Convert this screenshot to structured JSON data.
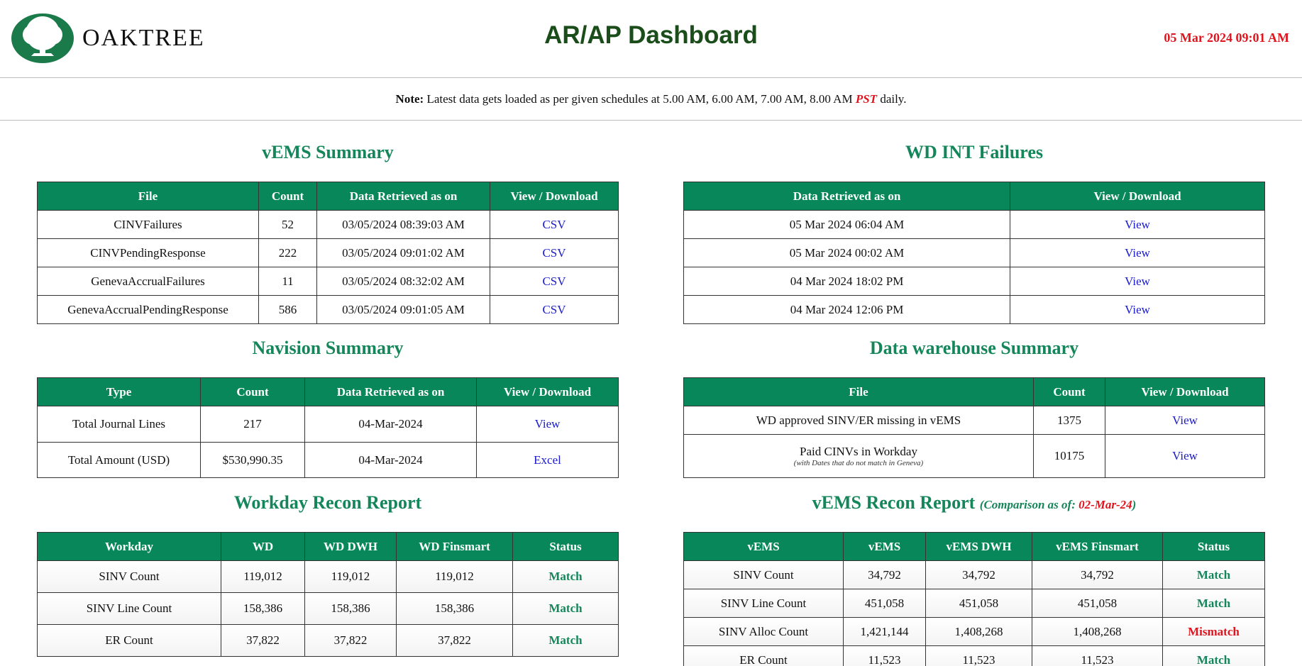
{
  "header": {
    "logo_text": "OAKTREE",
    "title": "AR/AP Dashboard",
    "datetime": "05 Mar 2024 09:01 AM"
  },
  "note": {
    "label": "Note:",
    "text": " Latest data gets loaded as per given schedules at 5.00 AM, 6.00 AM, 7.00 AM, 8.00 AM ",
    "pst": "PST",
    "tail": " daily."
  },
  "vems_summary": {
    "title": "vEMS Summary",
    "headers": [
      "File",
      "Count",
      "Data Retrieved as on",
      "View / Download"
    ],
    "rows": [
      {
        "file": "CINVFailures",
        "count": "52",
        "date": "03/05/2024 08:39:03 AM",
        "link": "CSV"
      },
      {
        "file": "CINVPendingResponse",
        "count": "222",
        "date": "03/05/2024 09:01:02 AM",
        "link": "CSV"
      },
      {
        "file": "GenevaAccrualFailures",
        "count": "11",
        "date": "03/05/2024 08:32:02 AM",
        "link": "CSV"
      },
      {
        "file": "GenevaAccrualPendingResponse",
        "count": "586",
        "date": "03/05/2024 09:01:05 AM",
        "link": "CSV"
      }
    ]
  },
  "wd_int": {
    "title": "WD INT Failures",
    "headers": [
      "Data Retrieved as on",
      "View / Download"
    ],
    "rows": [
      {
        "date": "05 Mar 2024 06:04 AM",
        "link": "View"
      },
      {
        "date": "05 Mar 2024 00:02 AM",
        "link": "View"
      },
      {
        "date": "04 Mar 2024 18:02 PM",
        "link": "View"
      },
      {
        "date": "04 Mar 2024 12:06 PM",
        "link": "View"
      }
    ]
  },
  "navision": {
    "title": "Navision Summary",
    "headers": [
      "Type",
      "Count",
      "Data Retrieved as on",
      "View / Download"
    ],
    "rows": [
      {
        "type": "Total Journal Lines",
        "count": "217",
        "date": "04-Mar-2024",
        "link": "View"
      },
      {
        "type": "Total Amount (USD)",
        "count": "$530,990.35",
        "date": "04-Mar-2024",
        "link": "Excel"
      }
    ]
  },
  "dwh": {
    "title": "Data warehouse Summary",
    "headers": [
      "File",
      "Count",
      "View / Download"
    ],
    "rows": [
      {
        "file": "WD approved SINV/ER missing in vEMS",
        "sub": "",
        "count": "1375",
        "link": "View"
      },
      {
        "file": "Paid CINVs in Workday",
        "sub": "(with Dates that do not match in Geneva)",
        "count": "10175",
        "link": "View"
      }
    ]
  },
  "workday_recon": {
    "title": "Workday Recon Report",
    "headers": [
      "Workday",
      "WD",
      "WD DWH",
      "WD Finsmart",
      "Status"
    ],
    "rows": [
      {
        "name": "SINV Count",
        "a": "119,012",
        "b": "119,012",
        "c": "119,012",
        "status": "Match"
      },
      {
        "name": "SINV Line Count",
        "a": "158,386",
        "b": "158,386",
        "c": "158,386",
        "status": "Match"
      },
      {
        "name": "ER Count",
        "a": "37,822",
        "b": "37,822",
        "c": "37,822",
        "status": "Match"
      }
    ]
  },
  "vems_recon": {
    "title": "vEMS Recon Report",
    "sub_prefix": "(Comparison as of: ",
    "sub_date": "02-Mar-24",
    "sub_suffix": ")",
    "headers": [
      "vEMS",
      "vEMS",
      "vEMS DWH",
      "vEMS Finsmart",
      "Status"
    ],
    "rows": [
      {
        "name": "SINV Count",
        "a": "34,792",
        "b": "34,792",
        "c": "34,792",
        "status": "Match"
      },
      {
        "name": "SINV Line Count",
        "a": "451,058",
        "b": "451,058",
        "c": "451,058",
        "status": "Match"
      },
      {
        "name": "SINV Alloc Count",
        "a": "1,421,144",
        "b": "1,408,268",
        "c": "1,408,268",
        "status": "Mismatch"
      },
      {
        "name": "ER Count",
        "a": "11,523",
        "b": "11,523",
        "c": "11,523",
        "status": "Match"
      }
    ]
  },
  "colors": {
    "green": "#07875a",
    "title_green": "#1a4d1a",
    "red": "#e0141e",
    "link": "#1a1acc"
  }
}
